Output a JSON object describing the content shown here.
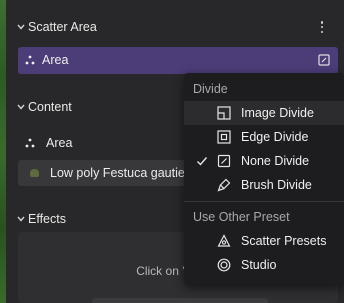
{
  "scatter_area": {
    "title": "Scatter Area",
    "item_label": "Area",
    "accent": "#4c3c78"
  },
  "content": {
    "title": "Content",
    "area_label": "Area",
    "asset_label": "Low poly Festuca gautier"
  },
  "effects": {
    "title": "Effects",
    "hint": "Click on '+' to crea"
  },
  "menu": {
    "divide_title": "Divide",
    "items": [
      {
        "label": "Image Divide",
        "icon": "image-divide-icon",
        "checked": false,
        "highlighted": true
      },
      {
        "label": "Edge Divide",
        "icon": "edge-divide-icon",
        "checked": false,
        "highlighted": false
      },
      {
        "label": "None Divide",
        "icon": "none-divide-icon",
        "checked": true,
        "highlighted": false
      },
      {
        "label": "Brush Divide",
        "icon": "brush-divide-icon",
        "checked": false,
        "highlighted": false
      }
    ],
    "preset_title": "Use Other Preset",
    "presets": [
      {
        "label": "Scatter Presets",
        "icon": "scatter-presets-icon"
      },
      {
        "label": "Studio",
        "icon": "studio-icon"
      }
    ]
  }
}
